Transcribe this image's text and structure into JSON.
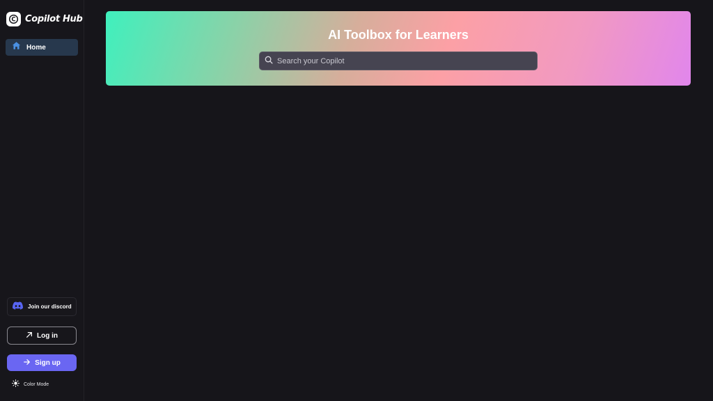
{
  "brand": {
    "name": "Copilot Hub",
    "logo_letter": "C"
  },
  "sidebar": {
    "nav": [
      {
        "label": "Home",
        "icon": "home-icon",
        "active": true
      }
    ],
    "discord_label": "Join our discord",
    "login_label": "Log in",
    "signup_label": "Sign up",
    "color_mode_label": "Color Mode"
  },
  "hero": {
    "title": "AI Toolbox for Learners",
    "search_placeholder": "Search your Copilot",
    "search_value": ""
  },
  "colors": {
    "background": "#16151a",
    "nav_active": "#27384d",
    "home_icon": "#4a90e2",
    "discord": "#5865f2",
    "signup": "#6a66f2",
    "gradient_start": "#3ff0bd",
    "gradient_mid": "#fca0a5",
    "gradient_end": "#e186ec"
  }
}
